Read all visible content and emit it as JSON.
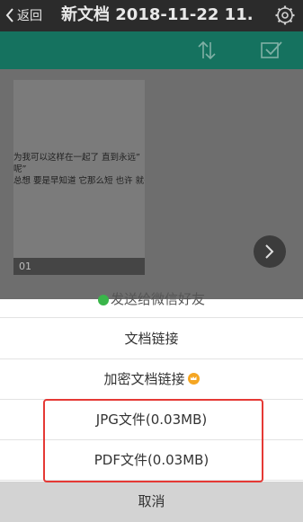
{
  "navbar": {
    "back_label": "返回",
    "title": "新文档 2018-11-22 11..."
  },
  "document": {
    "thumbnail_lines": [
      "为我可以这样在一起了 直到永远”",
      "呢”",
      "总想 要是早知道 它那么短 也许 就省着"
    ],
    "page_number": "01"
  },
  "share_sheet": {
    "wechat_label": "发送给微信好友",
    "doc_link_label": "文档链接",
    "encrypted_link_label": "加密文档链接",
    "jpg_label": "JPG文件(0.03MB)",
    "pdf_label": "PDF文件(0.03MB)",
    "cancel_label": "取消"
  },
  "colors": {
    "toolbar_green": "#15725f",
    "highlight_red": "#e53935",
    "vip_gold": "#f5a623"
  },
  "icons": [
    "back-chevron-icon",
    "gear-icon",
    "sort-icon",
    "checkmark-icon",
    "next-arrow-icon",
    "wechat-icon",
    "vip-crown-icon"
  ]
}
